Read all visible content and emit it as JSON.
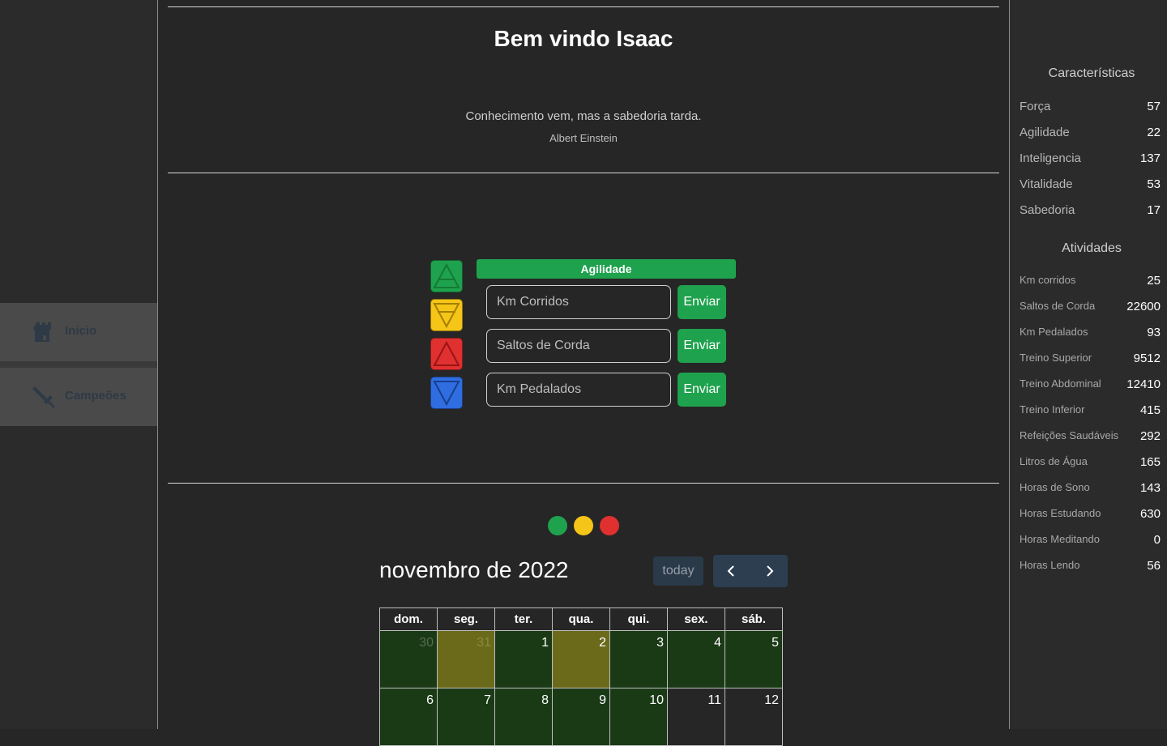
{
  "sidebar": {
    "items": [
      {
        "label": "Início",
        "icon": "castle-icon"
      },
      {
        "label": "Campeões",
        "icon": "sword-icon"
      }
    ]
  },
  "main": {
    "title": "Bem vindo Isaac",
    "quote": "Conhecimento vem, mas a sabedoria tarda.",
    "author": "Albert Einstein"
  },
  "activity": {
    "current": "Agilidade",
    "current_color": "#1fa24d",
    "elements": [
      {
        "name": "air",
        "color": "#1fa24d"
      },
      {
        "name": "earth",
        "color": "#f5c518"
      },
      {
        "name": "fire",
        "color": "#e03030"
      },
      {
        "name": "water",
        "color": "#2f6de0"
      }
    ],
    "fields": [
      {
        "placeholder": "Km Corridos",
        "button": "Enviar"
      },
      {
        "placeholder": "Saltos de Corda",
        "button": "Enviar"
      },
      {
        "placeholder": "Km Pedalados",
        "button": "Enviar"
      }
    ]
  },
  "legend_dots": [
    "#1fa24d",
    "#f5c518",
    "#e03030"
  ],
  "calendar": {
    "title": "novembro de 2022",
    "today_label": "today",
    "weekdays": [
      "dom.",
      "seg.",
      "ter.",
      "qua.",
      "qui.",
      "sex.",
      "sáb."
    ],
    "rows": [
      [
        "30",
        "31",
        "1",
        "2",
        "3",
        "4",
        "5"
      ],
      [
        "6",
        "7",
        "8",
        "9",
        "10",
        "11",
        "12"
      ]
    ]
  },
  "characteristics": {
    "title": "Características",
    "items": [
      {
        "label": "Força",
        "value": "57"
      },
      {
        "label": "Agilidade",
        "value": "22"
      },
      {
        "label": "Inteligencia",
        "value": "137"
      },
      {
        "label": "Vitalidade",
        "value": "53"
      },
      {
        "label": "Sabedoria",
        "value": "17"
      }
    ]
  },
  "activities": {
    "title": "Atividades",
    "items": [
      {
        "label": "Km corridos",
        "value": "25"
      },
      {
        "label": "Saltos de Corda",
        "value": "22600"
      },
      {
        "label": "Km Pedalados",
        "value": "93"
      },
      {
        "label": "Treino Superior",
        "value": "9512"
      },
      {
        "label": "Treino Abdominal",
        "value": "12410"
      },
      {
        "label": "Treino Inferior",
        "value": "415"
      },
      {
        "label": "Refeições Saudáveis",
        "value": "292"
      },
      {
        "label": "Litros de Água",
        "value": "165"
      },
      {
        "label": "Horas de Sono",
        "value": "143"
      },
      {
        "label": "Horas Estudando",
        "value": "630"
      },
      {
        "label": "Horas Meditando",
        "value": "0"
      },
      {
        "label": "Horas Lendo",
        "value": "56"
      }
    ]
  }
}
